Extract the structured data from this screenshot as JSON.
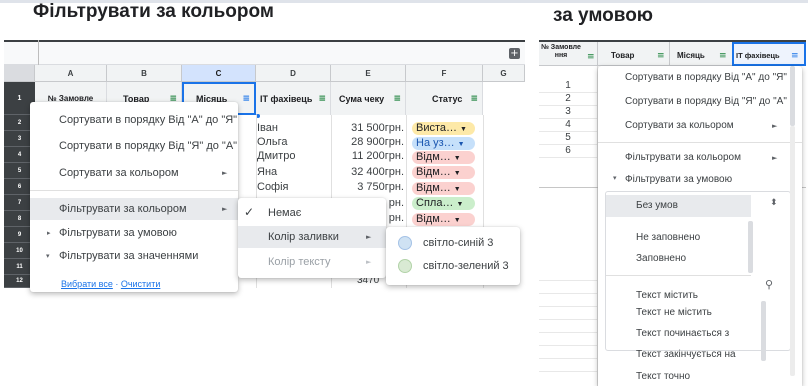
{
  "headings": {
    "left": "Фільтрувати за кольором",
    "right": "за умовою"
  },
  "left_sheet": {
    "columns": [
      "A",
      "B",
      "C",
      "D",
      "E",
      "F",
      "G"
    ],
    "header_row_number": "1",
    "row_numbers": [
      "2",
      "3",
      "4",
      "5",
      "6",
      "7",
      "8",
      "9",
      "10",
      "11",
      "12"
    ],
    "headers": [
      "№ Замовле",
      "Товар",
      "Місяць",
      "ІТ фахівець",
      "Сума чеку",
      "Статус"
    ],
    "visible_names": [
      "Іван",
      "Ольга",
      "Дмитро",
      "Яна",
      "Софія"
    ],
    "visible_sums": [
      "31 500грн.",
      "28 900грн.",
      "11 200грн.",
      "32 400грн.",
      "3 750грн.",
      "рн.",
      "рн."
    ],
    "partial_sum_bottom": "3470",
    "status_chips": [
      {
        "text": "Виста…",
        "color": "#fde9a8"
      },
      {
        "text": "На уз…",
        "color": "#c6e0fa"
      },
      {
        "text": "Відм…",
        "color": "#fbd1cf"
      },
      {
        "text": "Відм…",
        "color": "#fbd1cf"
      },
      {
        "text": "Відм…",
        "color": "#fbd1cf"
      },
      {
        "text": "Спла…",
        "color": "#cbeecb"
      },
      {
        "text": "Відм…",
        "color": "#fbd1cf"
      }
    ],
    "add_icon": "plus-box-icon"
  },
  "left_menu": {
    "items": [
      "Сортувати в порядку Від \"А\" до \"Я\"",
      "Сортувати в порядку Від \"Я\" до \"А\"",
      "Сортувати за кольором",
      "Фільтрувати за кольором",
      "Фільтрувати за умовою",
      "Фільтрувати за значеннями"
    ],
    "select_all": "Вибрати все",
    "link_separator": " · ",
    "clear": "Очистити"
  },
  "color_submenu": {
    "none": "Немає",
    "fill": "Колір заливки",
    "text": "Колір тексту"
  },
  "fill_submenu": {
    "options": [
      {
        "label": "світло-синій 3",
        "color": "#cfe2f3"
      },
      {
        "label": "світло-зелений 3",
        "color": "#d9ead3"
      }
    ]
  },
  "right_sheet": {
    "headers": [
      "№ Замовле ння",
      "Товар",
      "Місяць",
      "ІТ фахівець"
    ],
    "row_numbers": [
      "1",
      "2",
      "3",
      "4",
      "5",
      "6"
    ]
  },
  "right_menu": {
    "items": [
      "Сортувати в порядку Від \"А\" до \"Я\"",
      "Сортувати в порядку Від \"Я\" до \"А\"",
      "Сортувати за кольором",
      "Фільтрувати за кольором",
      "Фільтрувати за умовою"
    ]
  },
  "condition_list": {
    "options": [
      "Без умов",
      "Не заповнено",
      "Заповнено",
      "Текст містить",
      "Текст не містить",
      "Текст починається з",
      "Текст закінчується на",
      "Текст точно"
    ]
  }
}
